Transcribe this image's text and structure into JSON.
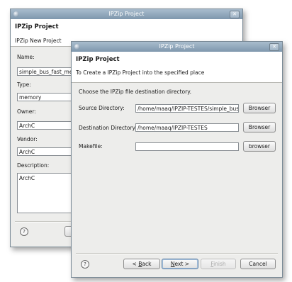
{
  "back_window": {
    "title": "IPZip Project",
    "header_title": "IPZip Project",
    "header_message": "IPZip New Project",
    "name_label": "Name:",
    "name_value": "simple_bus_fast_me",
    "type_label": "Type:",
    "type_value": "memory",
    "owner_label": "Owner:",
    "owner_value": "ArchC",
    "vendor_label": "Vendor:",
    "vendor_value": "ArchC",
    "description_label": "Description:",
    "description_value": "ArchC",
    "help_glyph": "?"
  },
  "front_window": {
    "title": "IPZip Project",
    "header_title": "IPZip Project",
    "header_message": "To Create a IPZip Project into the specified place",
    "instruction": "Choose the IPZip file destination directory.",
    "source_label": "Source Directory:",
    "source_value": "/home/maaq/IPZIP-TESTES/simple_bus",
    "source_button": "Browser",
    "dest_label": "Destination Directory:",
    "dest_value": "/home/maaq/IPZIP-TESTES",
    "dest_button": "Browser",
    "makefile_label": "Makefile:",
    "makefile_value": "",
    "makefile_button": "browser",
    "help_glyph": "?",
    "back_prefix": "< ",
    "back_mnemonic": "B",
    "back_rest": "ack",
    "next_mnemonic": "N",
    "next_rest": "ext >",
    "finish_mnemonic": "F",
    "finish_rest": "inish",
    "cancel_button": "Cancel"
  },
  "icons": {
    "app": "app-icon",
    "close": "close-icon",
    "help": "help-icon"
  },
  "colors": {
    "titlebar": "#8fa6ba",
    "dialog_bg": "#ededeb",
    "header_bg": "#ffffff"
  }
}
